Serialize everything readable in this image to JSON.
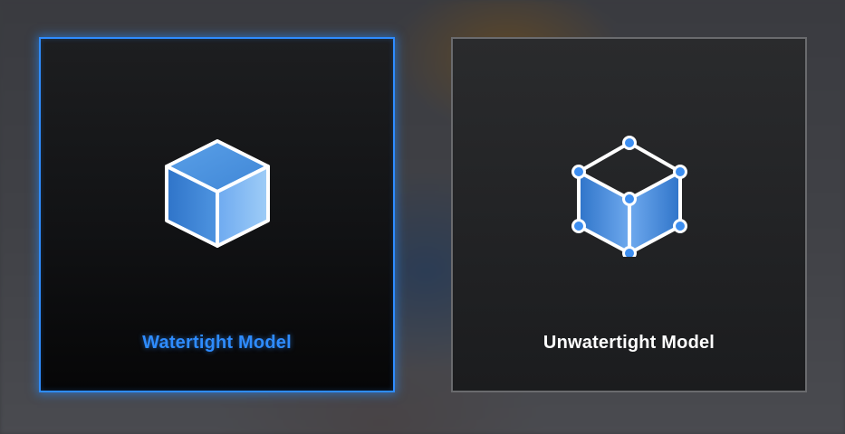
{
  "options": [
    {
      "label": "Watertight Model",
      "icon": "solid-cube-icon",
      "selected": true
    },
    {
      "label": "Unwatertight Model",
      "icon": "wireframe-cube-icon",
      "selected": false
    }
  ],
  "colors": {
    "accent": "#2e8cff",
    "selected_text": "#2e8cff",
    "unselected_text": "#ffffff",
    "unselected_border": "#6a6b6e",
    "cube_light": "#8fc4f5",
    "cube_dark": "#2f74c9"
  }
}
